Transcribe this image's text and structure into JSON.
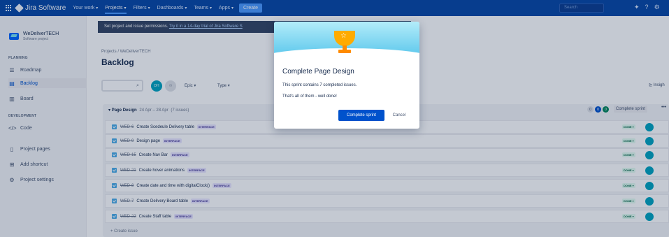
{
  "topnav": {
    "brand": "Jira Software",
    "items": [
      {
        "label": "Your work"
      },
      {
        "label": "Projects"
      },
      {
        "label": "Filters"
      },
      {
        "label": "Dashboards"
      },
      {
        "label": "Teams"
      },
      {
        "label": "Apps"
      }
    ],
    "create_label": "Create",
    "search_placeholder": "Search"
  },
  "sidebar": {
    "project_name": "WeDeliverTECH",
    "project_type": "Software project",
    "planning_label": "PLANNING",
    "development_label": "DEVELOPMENT",
    "items": [
      {
        "label": "Roadmap",
        "icon": "roadmap-icon"
      },
      {
        "label": "Backlog",
        "icon": "backlog-icon"
      },
      {
        "label": "Board",
        "icon": "board-icon"
      },
      {
        "label": "Code",
        "icon": "code-icon"
      },
      {
        "label": "Project pages",
        "icon": "pages-icon"
      },
      {
        "label": "Add shortcut",
        "icon": "add-shortcut-icon"
      },
      {
        "label": "Project settings",
        "icon": "gear-icon"
      }
    ]
  },
  "banner": {
    "text": "Set project and issue permissions. ",
    "link": "Try it in a 14-day trial of Jira Software S"
  },
  "breadcrumb": "Projects / WeDeliverTECH",
  "page_title": "Backlog",
  "filters": {
    "epic_label": "Epic",
    "type_label": "Type",
    "insights_label": "Insigh",
    "avatar_initials": "DH"
  },
  "sprint": {
    "name": "Page Design",
    "dates": "24 Apr – 28 Apr",
    "issue_count": "(7 issues)",
    "counts": [
      "0",
      "0",
      "0"
    ],
    "complete_label": "Complete sprint",
    "create_issue": "+ Create issue",
    "issues": [
      {
        "key": "WED-6",
        "summary": "Create Scedeule Delivery table",
        "epic": "INTERFACE",
        "status": "DONE"
      },
      {
        "key": "WED-9",
        "summary": "Design page",
        "epic": "INTERFACE",
        "status": "DONE"
      },
      {
        "key": "WED-15",
        "summary": "Create Nav Bar",
        "epic": "INTERFACE",
        "status": "DONE"
      },
      {
        "key": "WED-21",
        "summary": "Create hover animations",
        "epic": "INTERFACE",
        "status": "DONE"
      },
      {
        "key": "WED-8",
        "summary": "Create date and time with digitalClock()",
        "epic": "INTERFACE",
        "status": "DONE"
      },
      {
        "key": "WED-7",
        "summary": "Create Delivery Board table",
        "epic": "INTERFACE",
        "status": "DONE"
      },
      {
        "key": "WED-22",
        "summary": "Create Staff table",
        "epic": "INTERFACE",
        "status": "DONE"
      }
    ]
  },
  "modal": {
    "title": "Complete Page Design",
    "text1": "This sprint contains 7 completed issues.",
    "text2": "That's all of them - well done!",
    "primary_label": "Complete sprint",
    "cancel_label": "Cancel"
  },
  "colors": {
    "nav_bg": "#0747a6",
    "primary": "#0052cc",
    "done_bg": "#e3fcef",
    "epic_bg": "#eae6ff"
  }
}
